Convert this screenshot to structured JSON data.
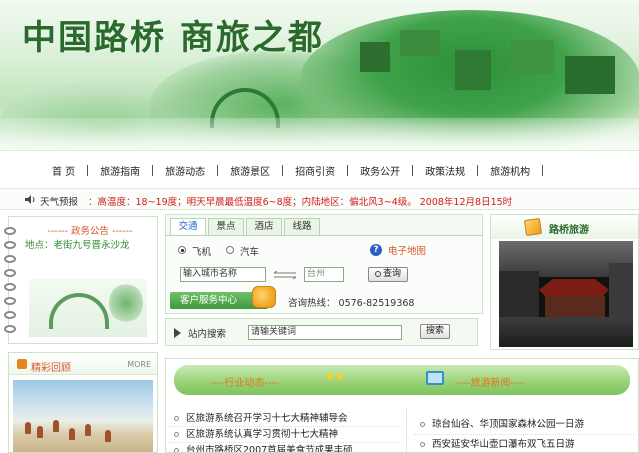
{
  "banner": {
    "title": "中国路桥 商旅之都"
  },
  "nav": {
    "items": [
      {
        "label": "首 页"
      },
      {
        "label": "旅游指南"
      },
      {
        "label": "旅游动态"
      },
      {
        "label": "旅游景区"
      },
      {
        "label": "招商引资"
      },
      {
        "label": "政务公开"
      },
      {
        "label": "政策法规"
      },
      {
        "label": "旅游机构"
      }
    ]
  },
  "ticker": {
    "label": "天气预报",
    "text": "：高温度：18~19度；明天早晨最低温度6~8度；内陆地区：偏北风3~4级。   2008年12月8日15时"
  },
  "notice": {
    "title": "------ 政务公告 ------",
    "address": "地点：老街九号晋永沙龙"
  },
  "photos": {
    "title": "精彩回顾",
    "more": "MORE"
  },
  "travel": {
    "tabs": [
      {
        "label": "交通",
        "active": true
      },
      {
        "label": "景点",
        "active": false
      },
      {
        "label": "酒店",
        "active": false
      },
      {
        "label": "线路",
        "active": false
      }
    ],
    "mode_plane": "飞机",
    "mode_car": "汽车",
    "map_link": "电子地图",
    "from_value": "输入城市名称",
    "to_value": "台州",
    "query_button": "查询",
    "service_center": "客户服务中心",
    "hotline": "咨询热线：  0576-82519368"
  },
  "search": {
    "label": "站内搜索",
    "value": "请输关键词",
    "button": "搜索"
  },
  "video": {
    "title": "路桥旅游"
  },
  "news": {
    "left_heading": "----行业动态----",
    "right_heading": "----旅游新闻----",
    "left_items": [
      {
        "text": "区旅游系统召开学习十七大精神辅导会"
      },
      {
        "text": "区旅游系统认真学习贯彻十七大精神"
      },
      {
        "text": "台州市路桥区2007首届美食节成果丰硕"
      }
    ],
    "right_items": [
      {
        "text": "琼台仙谷、华顶国家森林公园一日游"
      },
      {
        "text": "西安延安华山壶口瀑布双飞五日游"
      }
    ]
  }
}
